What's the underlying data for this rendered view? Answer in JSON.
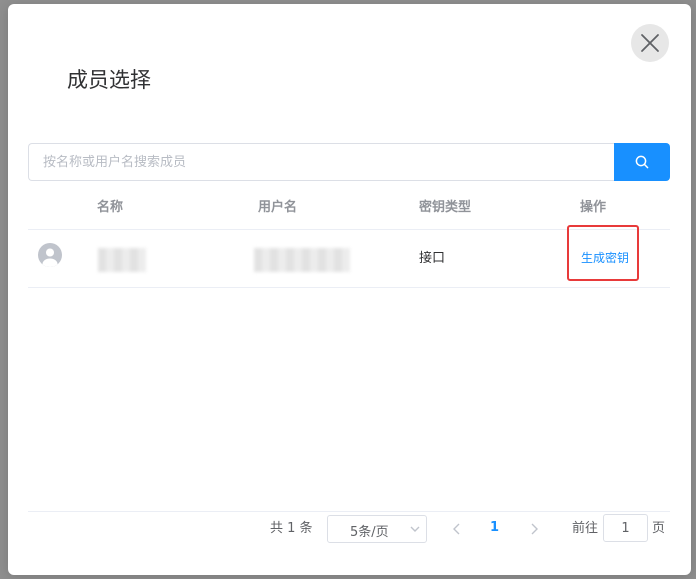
{
  "dialog": {
    "title": "成员选择"
  },
  "search": {
    "placeholder": "按名称或用户名搜索成员",
    "value": ""
  },
  "table": {
    "columns": [
      "名称",
      "用户名",
      "密钥类型",
      "操作"
    ],
    "rows": [
      {
        "key_type": "接口",
        "action_label": "生成密钥"
      }
    ]
  },
  "pagination": {
    "total_text": "共 1 条",
    "page_size": "5条/页",
    "current_page": "1",
    "goto_label": "前往",
    "goto_value": "1",
    "page_suffix": "页"
  },
  "colors": {
    "accent": "#1890ff",
    "highlight_border": "#e83a3a"
  },
  "icons": [
    "close-icon",
    "search-icon",
    "user-avatar-icon",
    "chevron-down-icon",
    "chevron-left-icon",
    "chevron-right-icon"
  ]
}
